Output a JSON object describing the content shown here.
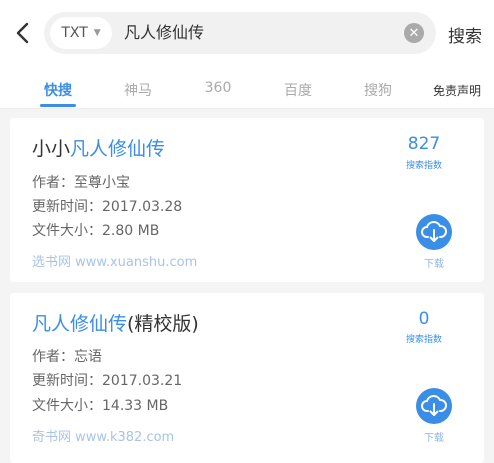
{
  "header": {
    "type_label": "TXT",
    "query_prefix": "凡人修仙传",
    "search_label": "搜索"
  },
  "tabs": [
    {
      "label": "快搜",
      "active": true
    },
    {
      "label": "神马",
      "active": false
    },
    {
      "label": "360",
      "active": false
    },
    {
      "label": "百度",
      "active": false
    },
    {
      "label": "搜狗",
      "active": false
    },
    {
      "label": "免责声明",
      "active": false
    }
  ],
  "results": [
    {
      "title_prefix": "小小",
      "title_highlight": "凡人修仙传",
      "title_suffix": "",
      "author": "作者：至尊小宝",
      "updated": "更新时间：2017.03.28",
      "size": "文件大小：2.80 MB",
      "source": "选书网 www.xuanshu.com",
      "count": "827",
      "count_label": "搜索指数",
      "download_label": "下载"
    },
    {
      "title_prefix": "",
      "title_highlight": "凡人修仙传",
      "title_suffix": "(精校版)",
      "author": "作者：忘语",
      "updated": "更新时间：2017.03.21",
      "size": "文件大小：14.33 MB",
      "source": "奇书网 www.k382.com",
      "count": "0",
      "count_label": "搜索指数",
      "download_label": "下载"
    }
  ],
  "colors": {
    "accent": "#3a8ee6",
    "source_text": "#a9c4e6",
    "background": "#f4f4f4"
  },
  "icons": {
    "back": "chevron-left-icon",
    "clear": "clear-circle-icon",
    "dropdown": "caret-down-icon",
    "download": "cloud-download-icon"
  }
}
